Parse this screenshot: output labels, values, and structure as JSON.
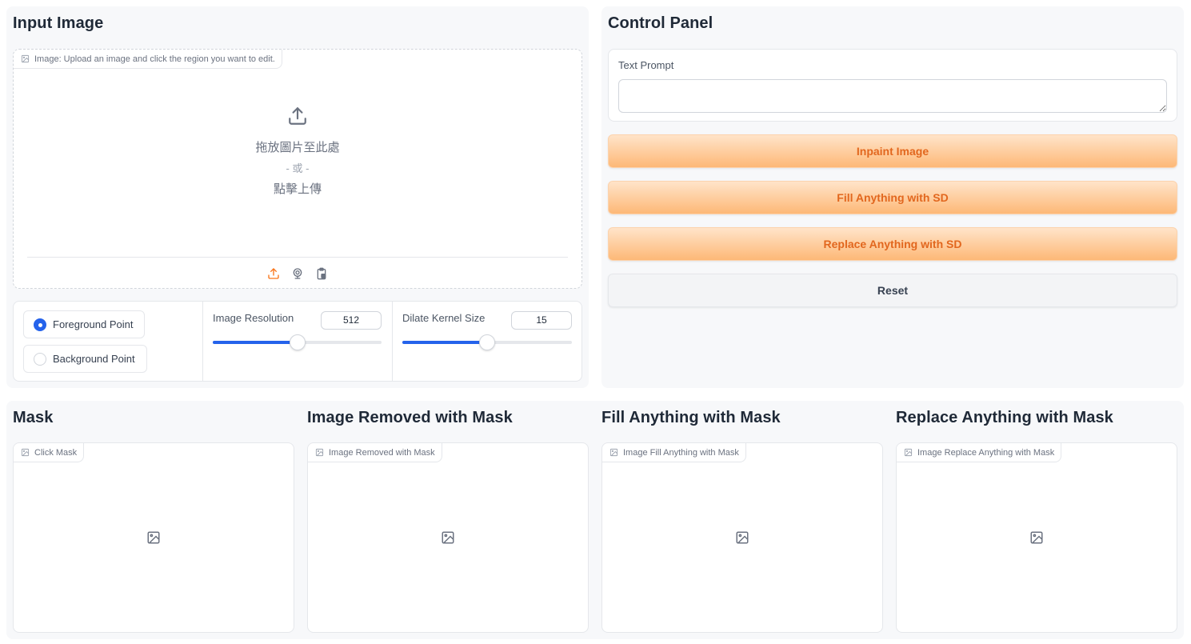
{
  "input_section": {
    "title": "Input Image",
    "image_label": "Image: Upload an image and click the region you want to edit.",
    "drop_text": "拖放圖片至此處",
    "or_text": "- 或 -",
    "click_text": "點擊上傳",
    "sources": [
      "upload-icon",
      "webcam-icon",
      "clipboard-icon"
    ]
  },
  "point_type": {
    "options": [
      "Foreground Point",
      "Background Point"
    ],
    "selected": "Foreground Point"
  },
  "image_resolution": {
    "label": "Image Resolution",
    "value": "512",
    "fraction": 0.5
  },
  "dilate_kernel": {
    "label": "Dilate Kernel Size",
    "value": "15",
    "fraction": 0.5
  },
  "control_panel": {
    "title": "Control Panel",
    "text_prompt_label": "Text Prompt",
    "text_prompt_value": "",
    "buttons": {
      "inpaint": "Inpaint Image",
      "fill": "Fill Anything with SD",
      "replace": "Replace Anything with SD",
      "reset": "Reset"
    }
  },
  "outputs": [
    {
      "title": "Mask",
      "label": "Click Mask"
    },
    {
      "title": "Image Removed with Mask",
      "label": "Image Removed with Mask"
    },
    {
      "title": "Fill Anything with Mask",
      "label": "Image Fill Anything with Mask"
    },
    {
      "title": "Replace Anything with Mask",
      "label": "Image Replace Anything with Mask"
    }
  ],
  "colors": {
    "accent": "#2563eb",
    "primary_button_text": "#e2671e",
    "primary_button_from": "#ffe4c9",
    "primary_button_to": "#fdb877",
    "panel_bg": "#f7f8fa"
  }
}
